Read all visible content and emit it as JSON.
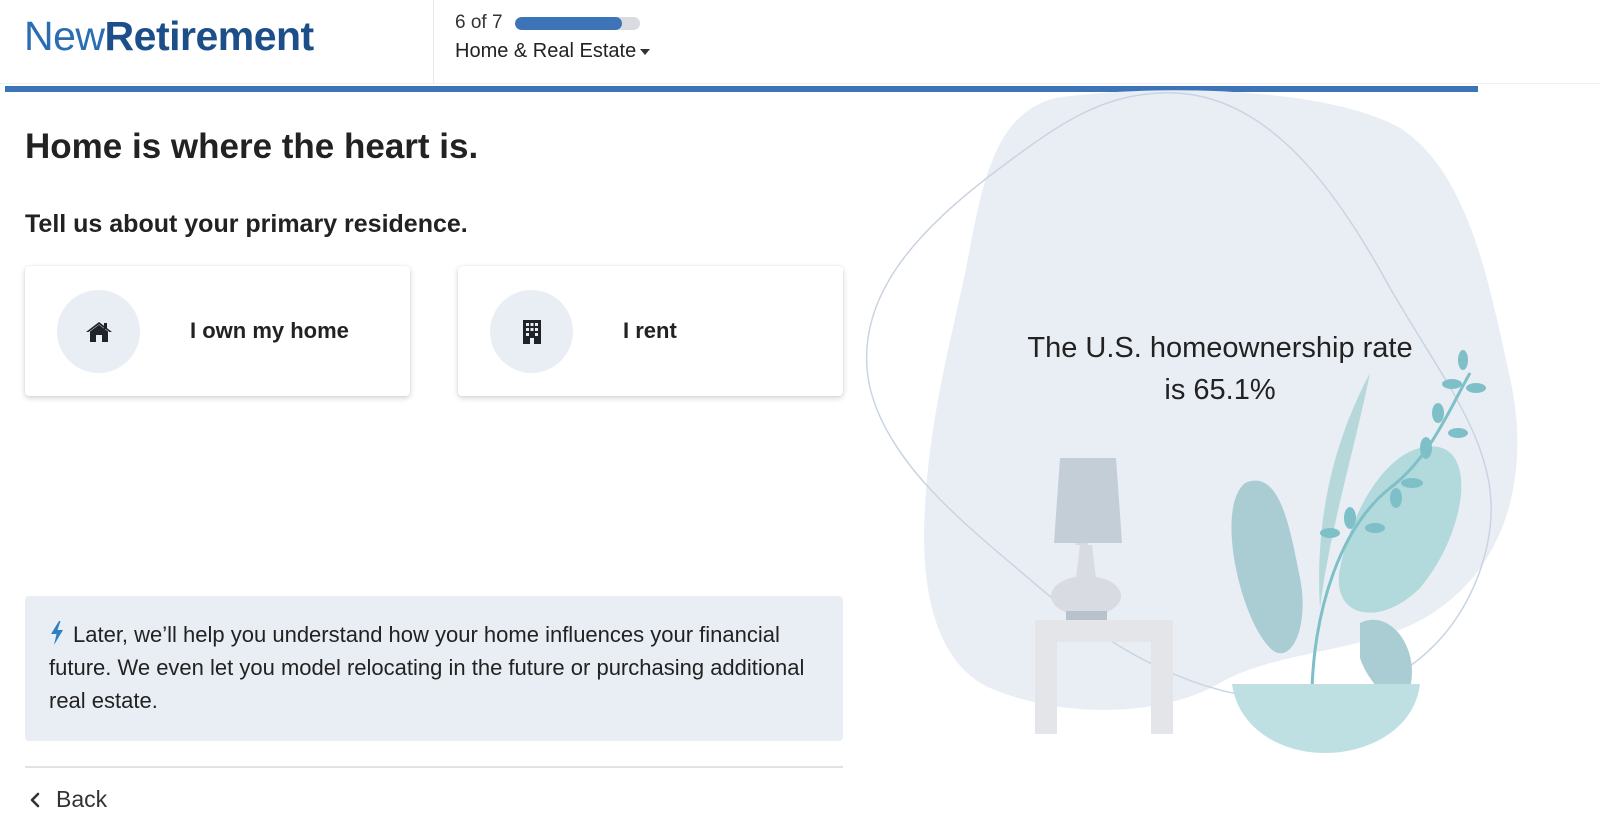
{
  "brand": {
    "part1": "New",
    "part2": "Retirement"
  },
  "progress": {
    "step_text": "6 of 7",
    "fraction": 0.857,
    "section_label": "Home & Real Estate"
  },
  "main": {
    "title": "Home is where the heart is.",
    "subtitle": "Tell us about your primary residence.",
    "options": [
      {
        "label": "I own my home",
        "icon": "home-icon"
      },
      {
        "label": "I rent",
        "icon": "building-icon"
      }
    ],
    "info": "Later, we’ll help you understand how your home influences your financial future. We even let you model relocating in the future or purchasing additional real estate.",
    "back_label": "Back"
  },
  "illustration": {
    "fact": "The U.S. homeownership rate is 65.1%"
  },
  "colors": {
    "brand_light": "#2a6db3",
    "brand_dark": "#1c4e8a",
    "accent": "#3d74b8",
    "panel": "#e9eef5"
  }
}
